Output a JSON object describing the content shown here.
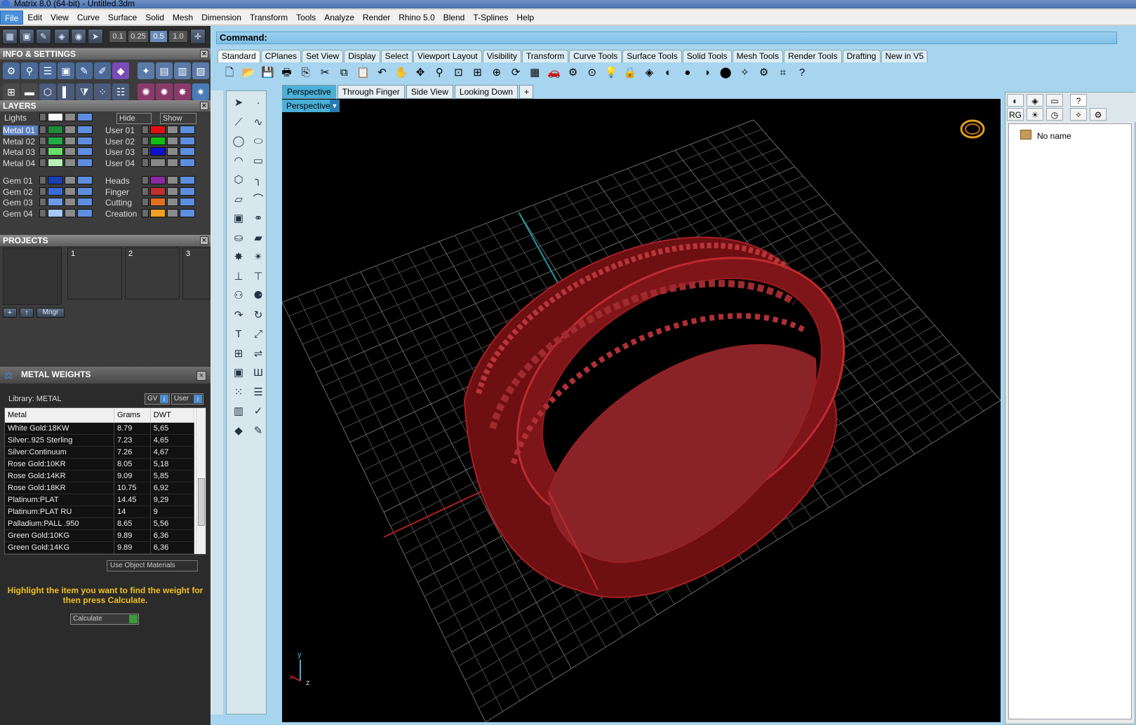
{
  "window": {
    "title": "Matrix 8.0 (64-bit) - Untitled.3dm"
  },
  "menu": [
    "File",
    "Edit",
    "View",
    "Curve",
    "Surface",
    "Solid",
    "Mesh",
    "Dimension",
    "Transform",
    "Tools",
    "Analyze",
    "Render",
    "Rhino 5.0",
    "Blend",
    "T-Splines",
    "Help"
  ],
  "left_toolbar": {
    "values": [
      "0.1",
      "0.25",
      "0.5",
      "1.0"
    ],
    "selected": "0.5"
  },
  "info": {
    "title": "INFO & SETTINGS"
  },
  "layers": {
    "title": "LAYERS",
    "lights_label": "Lights",
    "hide_label": "Hide",
    "show_label": "Show",
    "left": [
      {
        "name": "Metal 01",
        "color": "#1e8a3a",
        "selected": true
      },
      {
        "name": "Metal 02",
        "color": "#22aa44"
      },
      {
        "name": "Metal 03",
        "color": "#66dd66"
      },
      {
        "name": "Metal 04",
        "color": "#b8f0b8"
      },
      {
        "name": "Gem 01",
        "color": "#1a3fb0"
      },
      {
        "name": "Gem 02",
        "color": "#3a6ad8"
      },
      {
        "name": "Gem 03",
        "color": "#6a98ea"
      },
      {
        "name": "Gem 04",
        "color": "#a8c8f4"
      }
    ],
    "right": [
      {
        "name": "User 01",
        "color": "#e01010"
      },
      {
        "name": "User 02",
        "color": "#10c010"
      },
      {
        "name": "User 03",
        "color": "#1010d0"
      },
      {
        "name": "User 04",
        "color": "#888888"
      },
      {
        "name": "Heads",
        "color": "#8a2aa0"
      },
      {
        "name": "Finger",
        "color": "#c03030"
      },
      {
        "name": "Cutting",
        "color": "#e07020"
      },
      {
        "name": "Creation",
        "color": "#f0a020"
      }
    ]
  },
  "projects": {
    "title": "PROJECTS",
    "slots": [
      "1",
      "2",
      "3"
    ],
    "mngr_label": "Mngr"
  },
  "metal_weights": {
    "title": "METAL WEIGHTS",
    "library_label": "Library: METAL",
    "gv_label": "GV",
    "user_label": "User",
    "columns": [
      "Metal",
      "Grams",
      "DWT"
    ],
    "rows": [
      [
        "White Gold:18KW",
        "8.79",
        "5,65"
      ],
      [
        "Silver:.925 Sterling",
        "7.23",
        "4,65"
      ],
      [
        "Silver:Continuum",
        "7.26",
        "4,67"
      ],
      [
        "Rose Gold:10KR",
        "8.05",
        "5,18"
      ],
      [
        "Rose Gold:14KR",
        "9.09",
        "5,85"
      ],
      [
        "Rose Gold:18KR",
        "10.75",
        "6,92"
      ],
      [
        "Platinum:PLAT",
        "14.45",
        "9,29"
      ],
      [
        "Platinum:PLAT RU",
        "14",
        "9"
      ],
      [
        "Palladium:PALL .950",
        "8.65",
        "5,56"
      ],
      [
        "Green Gold:10KG",
        "9.89",
        "6,36"
      ],
      [
        "Green Gold:14KG",
        "9.89",
        "6,36"
      ]
    ],
    "use_object_materials": "Use Object Materials",
    "hint": "Highlight the item you want to find the weight for then press Calculate.",
    "calculate_label": "Calculate"
  },
  "command": {
    "label": "Command:"
  },
  "toolbar_tabs": [
    "Standard",
    "CPlanes",
    "Set View",
    "Display",
    "Select",
    "Viewport Layout",
    "Visibility",
    "Transform",
    "Curve Tools",
    "Surface Tools",
    "Solid Tools",
    "Mesh Tools",
    "Render Tools",
    "Drafting",
    "New in V5"
  ],
  "viewport_tabs": [
    "Perspective",
    "Through Finger",
    "Side View",
    "Looking Down"
  ],
  "viewport": {
    "name": "Perspective"
  },
  "right_panel": {
    "item": "No name"
  },
  "colors": {
    "ring": "#8a1a1a",
    "accent": "#4ab0d8",
    "hint": "#f0c020"
  }
}
